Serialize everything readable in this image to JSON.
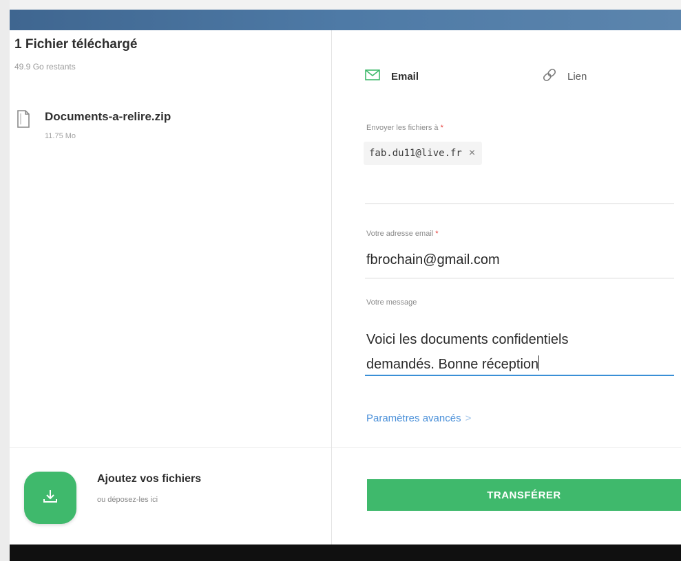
{
  "upload_panel": {
    "title": "1 Fichier téléchargé",
    "remaining": "49.9 Go restants",
    "files": [
      {
        "name": "Documents-a-relire.zip",
        "size": "11.75 Mo",
        "icon": "file-icon"
      }
    ]
  },
  "add_files": {
    "icon": "download-icon",
    "title": "Ajoutez vos fichiers",
    "subtitle": "ou déposez-les ici"
  },
  "tabs": [
    {
      "label": "Email",
      "icon": "envelope-icon",
      "active": true
    },
    {
      "label": "Lien",
      "icon": "link-icon",
      "active": false
    }
  ],
  "form": {
    "recipients_label": "Envoyer les fichiers à",
    "recipients": [
      "fab.du11@live.fr"
    ],
    "remove_symbol": "×",
    "required_marker": "*",
    "sender_label": "Votre adresse email",
    "sender_value": "fbrochain@gmail.com",
    "message_label": "Votre message",
    "message_value": "Voici les documents confidentiels\ndemandés. Bonne réception",
    "advanced_label": "Paramètres avancés",
    "advanced_chevron": ">"
  },
  "transfer_button": {
    "label": "TRANSFÉRER"
  },
  "colors": {
    "accent": "#3fb96c",
    "link": "#4a90d9",
    "topbar": "#4e7aa6",
    "required": "#e53935"
  }
}
